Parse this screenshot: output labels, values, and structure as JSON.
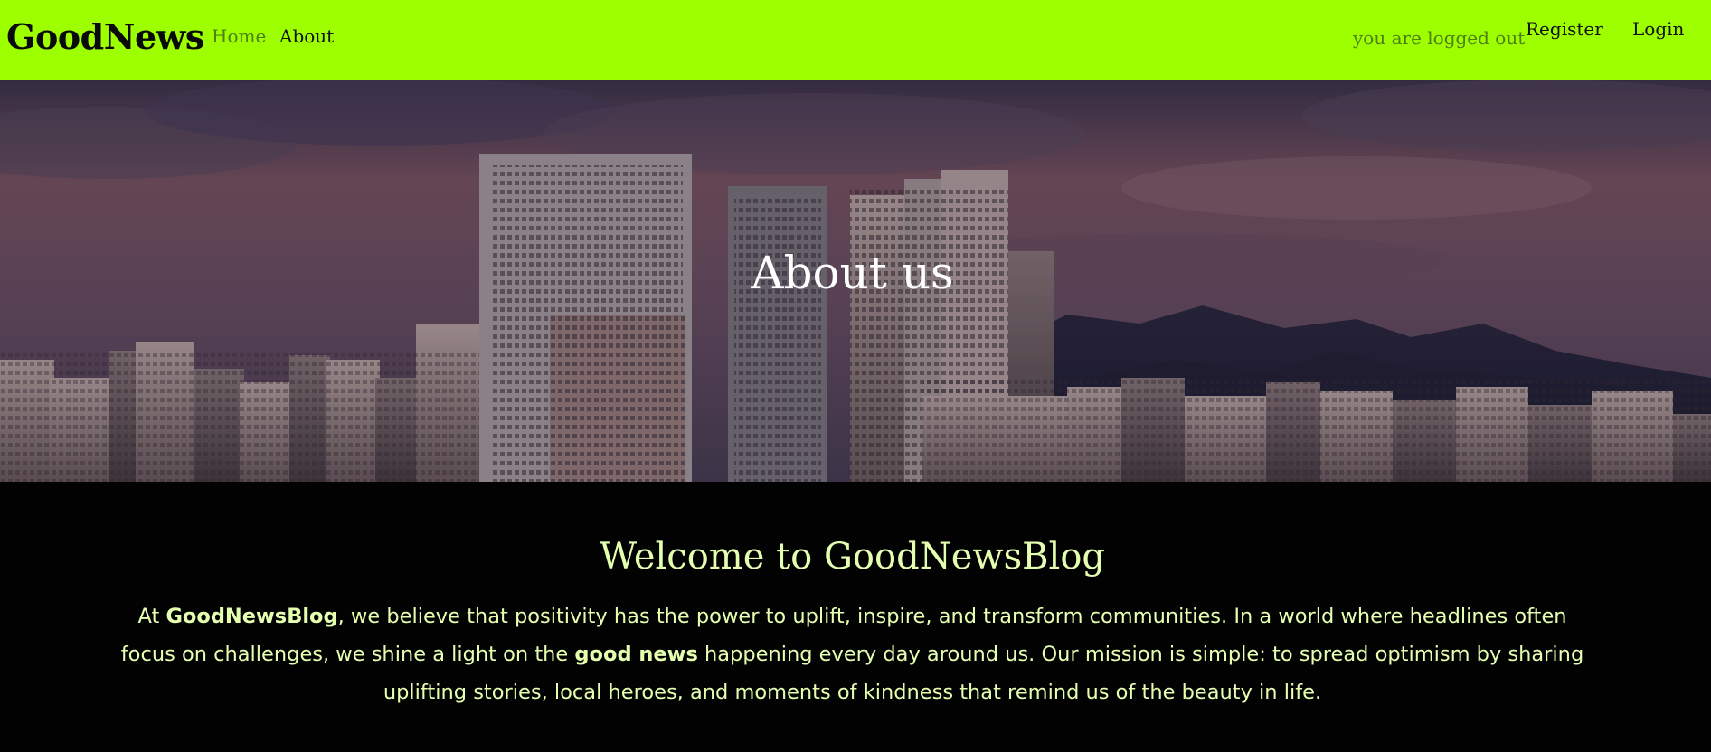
{
  "navbar": {
    "brand": "GoodNews",
    "links": [
      {
        "label": "Home"
      },
      {
        "label": "About"
      }
    ],
    "status": "you are logged out",
    "register_label": "Register",
    "login_label": "Login",
    "background_color": "#9dff00"
  },
  "hero": {
    "title": "About us",
    "image": "city skyline at dusk with mountains"
  },
  "content": {
    "heading": "Welcome to GoodNewsBlog",
    "paragraph": {
      "part1": "At ",
      "bold1": "GoodNewsBlog",
      "part2": ", we believe that positivity has the power to uplift, inspire, and transform communities. In a world where headlines often focus on challenges, we shine a light on the ",
      "bold2": "good news",
      "part3": " happening every day around us. Our mission is simple: to spread optimism by sharing uplifting stories, local heroes, and moments of kindness that remind us of the beauty in life."
    },
    "text_color": "#e5ffb0"
  }
}
